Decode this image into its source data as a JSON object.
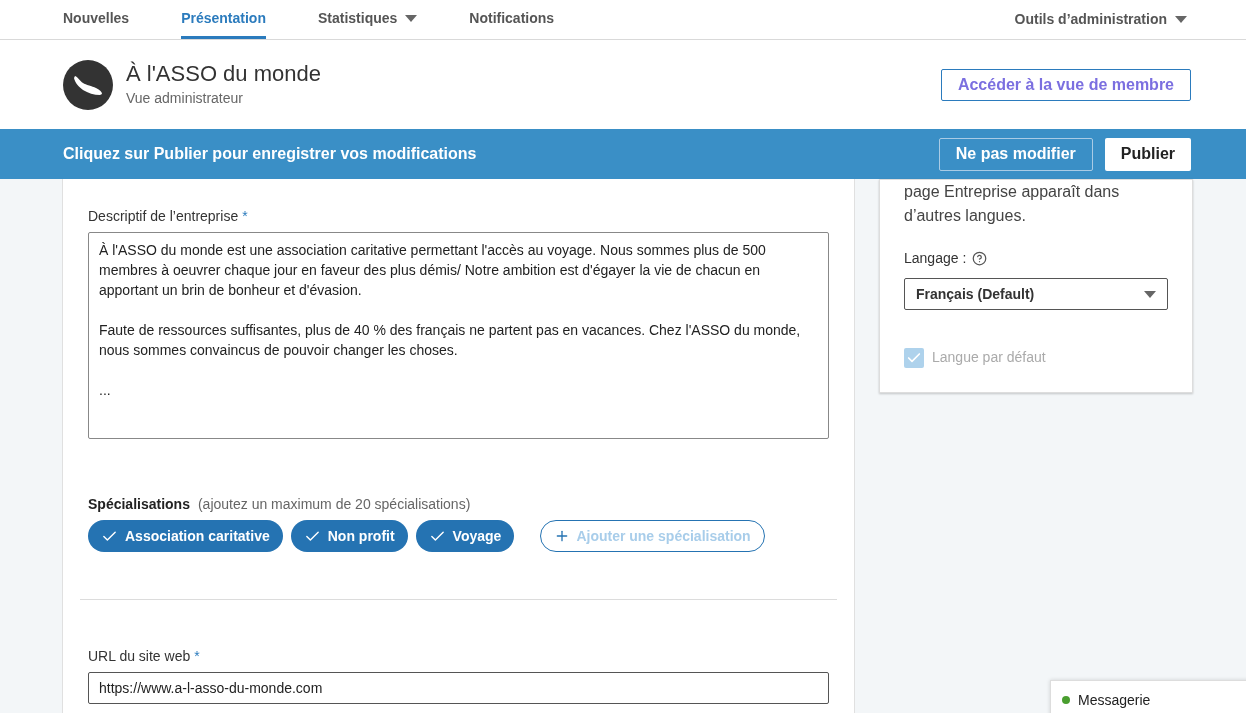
{
  "nav": {
    "tabs": [
      {
        "label": "Nouvelles",
        "selected": false,
        "dropdown": false
      },
      {
        "label": "Présentation",
        "selected": true,
        "dropdown": false
      },
      {
        "label": "Statistiques",
        "selected": false,
        "dropdown": true
      },
      {
        "label": "Notifications",
        "selected": false,
        "dropdown": false
      }
    ],
    "admin_tools": "Outils d’administration"
  },
  "header": {
    "name": "À l'ASSO du monde",
    "subtitle": "Vue administrateur",
    "member_view_button": "Accéder à la vue de membre"
  },
  "banner": {
    "message": "Cliquez sur Publier pour enregistrer vos modifications",
    "cancel_button": "Ne pas modifier",
    "publish_button": "Publier"
  },
  "about": {
    "description_label": "Descriptif de l’entreprise",
    "description_required": "*",
    "description_paragraphs": [
      "À l'ASSO du monde est une association caritative permettant l'accès au voyage. Nous sommes plus de 500 membres à oeuvrer chaque jour en faveur des plus démis/ Notre ambition est d'égayer la vie de chacun en apportant un brin de bonheur et d'évasion.",
      "Faute de ressources suffisantes, plus de 40 % des français ne partent pas en vacances. Chez l'ASSO du monde, nous sommes convaincus de pouvoir changer les choses.",
      "..."
    ],
    "specialisations_label": "Spécialisations",
    "specialisations_hint": "(ajoutez un maximum de 20 spécialisations)",
    "specialisations": [
      "Association caritative",
      "Non profit",
      "Voyage"
    ],
    "add_specialisation": "Ajouter une spécialisation",
    "url_label": "URL du site web",
    "url_required": "*",
    "url_value": "https://www.a-l-asso-du-monde.com"
  },
  "language_card": {
    "description": "page Entreprise apparaît dans d’autres langues.",
    "language_label": "Langage :",
    "language_value": "Français (Default)",
    "default_language": {
      "label": "Langue par défaut",
      "checked": true,
      "disabled": true
    }
  },
  "messaging": {
    "label": "Messagerie",
    "online": true
  }
}
